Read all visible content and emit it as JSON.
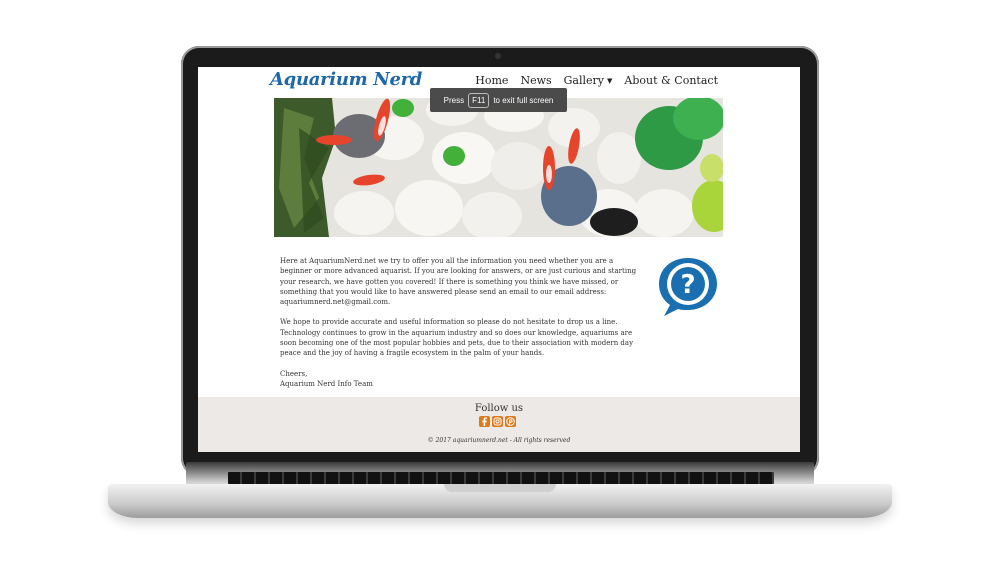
{
  "site": {
    "logo": "Aquarium Nerd",
    "nav": [
      {
        "label": "Home"
      },
      {
        "label": "News"
      },
      {
        "label": "Gallery"
      },
      {
        "label": "About & Contact"
      }
    ]
  },
  "toast": {
    "press": "Press",
    "key": "F11",
    "rest": "to exit full screen"
  },
  "content": {
    "p1": "Here at AquariumNerd.net we try to offer you all the information you need whether you are a beginner or more advanced aquarist. If you are looking for answers, or are just curious and starting your research, we have gotten you covered! If there is something you think we have missed, or something that you would like to have answered please send an email to our email address: aquariumnerd.net@gmail.com.",
    "p2": "We hope to provide accurate and useful information so please do not hesitate to drop us a line. Technology continues to grow in the aquarium industry and so does our knowledge, aquariums are soon becoming one of the most popular hobbies and pets, due to their association with modern day peace and the joy of having a fragile ecosystem in the palm of your hands.",
    "sign1": "Cheers,",
    "sign2": "Aquarium Nerd Info Team"
  },
  "footer": {
    "follow": "Follow us",
    "social_icons": [
      "facebook-icon",
      "instagram-icon",
      "pinterest-icon"
    ],
    "copyright": "© 2017 aquariumnerd.net - All rights reserved"
  },
  "colors": {
    "brand": "#1e67a8",
    "social": "#dd7a1c",
    "footer_bg": "#ece9e6"
  }
}
